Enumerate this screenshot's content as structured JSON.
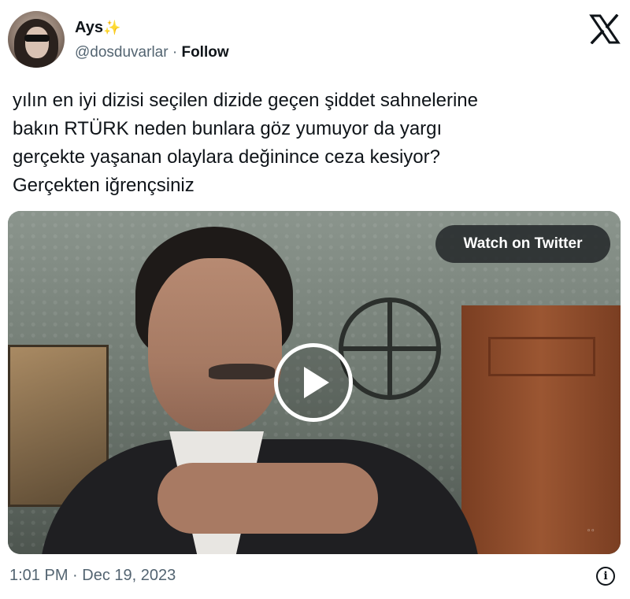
{
  "author": {
    "display_name": "Ays",
    "sparkle": "✨",
    "handle": "@dosduvarlar",
    "separator": " · ",
    "follow_label": "Follow"
  },
  "brand": {
    "logo_icon": "x-logo-icon"
  },
  "tweet": {
    "text": "yılın en iyi dizisi seçilen dizide geçen şiddet sahnelerine\nbakın RTÜRK neden bunlara göz yumuyor da yargı\ngerçekte yaşanan olaylara değinince ceza kesiyor?\nGerçekten iğrençsiniz"
  },
  "media": {
    "watch_label": "Watch on Twitter",
    "play_icon": "play-icon"
  },
  "footer": {
    "timestamp": "1:01 PM · Dec 19, 2023",
    "info_icon": "info-icon"
  }
}
